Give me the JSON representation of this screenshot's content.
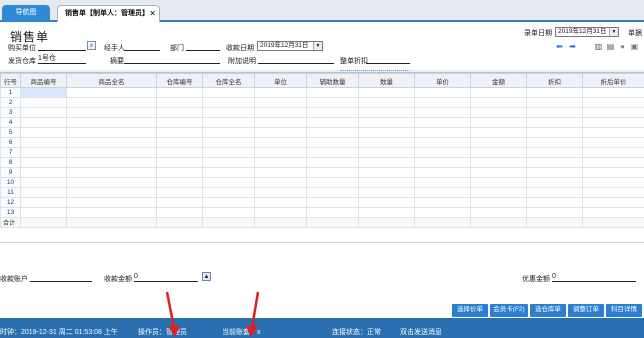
{
  "tabs": [
    {
      "label": "导航图"
    },
    {
      "label": "销售单【制单人：管理员】"
    }
  ],
  "tab_close_glyph": "✕",
  "form": {
    "title": "销售单",
    "record_date_label": "录单日期",
    "record_date_value": "2019年12月31日",
    "doc_no_label": "单据",
    "buyer_label": "购买单位",
    "handler_label": "经手人",
    "dept_label": "部门",
    "collect_date_label": "收款日期",
    "collect_date_value": "2019年12月31日",
    "warehouse_label": "发货仓库",
    "warehouse_value": "1号仓",
    "summary_label": "摘要",
    "note_label": "附加说明",
    "discount_label": "整单折扣"
  },
  "grid": {
    "columns": [
      "行号",
      "商品编号",
      "商品全名",
      "仓库编号",
      "仓库全名",
      "单位",
      "辅助数量",
      "数量",
      "单价",
      "金额",
      "折扣",
      "折后单价"
    ],
    "rows": [
      "1",
      "2",
      "3",
      "4",
      "5",
      "6",
      "7",
      "8",
      "9",
      "10",
      "11",
      "12",
      "13"
    ],
    "total_label": "合计"
  },
  "bottom": {
    "account_label": "收款账户",
    "amount_label": "收款金额",
    "amount_value": "0",
    "promo_label": "优惠金额",
    "promo_value": "0"
  },
  "buttons": [
    "选择价单",
    "会员卡(F2)",
    "选仓库单",
    "调整订单",
    "科目详情"
  ],
  "status": {
    "time": "时钟：2019-12-31 周二 01:53:08 上午",
    "operator": "操作员：管理员",
    "account_set": "当前账套：x",
    "connection": "连接状态：正常",
    "send": "双击发送消息"
  },
  "colors": {
    "accent": "#2b7fd1",
    "status_bar": "#2a6fb0",
    "annotation_arrow": "#e02020"
  }
}
